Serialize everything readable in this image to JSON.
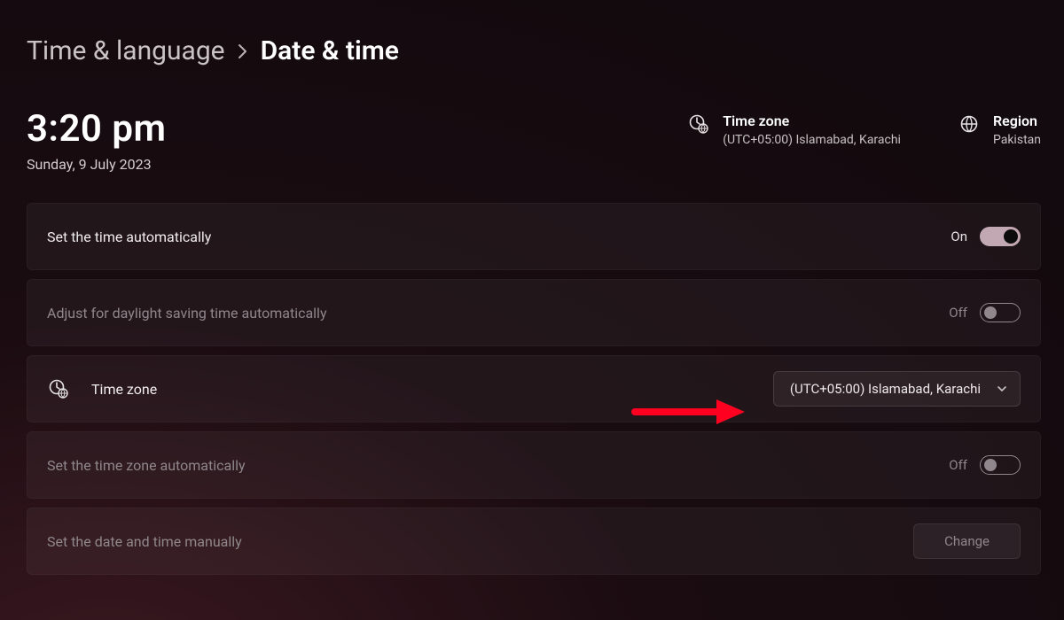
{
  "breadcrumb": {
    "parent": "Time & language",
    "current": "Date & time"
  },
  "clock": {
    "time": "3:20 pm",
    "date": "Sunday, 9 July 2023"
  },
  "header_info": {
    "timezone": {
      "title": "Time zone",
      "value": "(UTC+05:00) Islamabad, Karachi"
    },
    "region": {
      "title": "Region",
      "value": "Pakistan"
    }
  },
  "rows": {
    "auto_time": {
      "label": "Set the time automatically",
      "toggle_label": "On",
      "state": "on"
    },
    "dst": {
      "label": "Adjust for daylight saving time automatically",
      "toggle_label": "Off",
      "state": "off"
    },
    "timezone": {
      "label": "Time zone",
      "dropdown_value": "(UTC+05:00) Islamabad, Karachi"
    },
    "auto_tz": {
      "label": "Set the time zone automatically",
      "toggle_label": "Off",
      "state": "off"
    },
    "manual": {
      "label": "Set the date and time manually",
      "button": "Change"
    }
  }
}
